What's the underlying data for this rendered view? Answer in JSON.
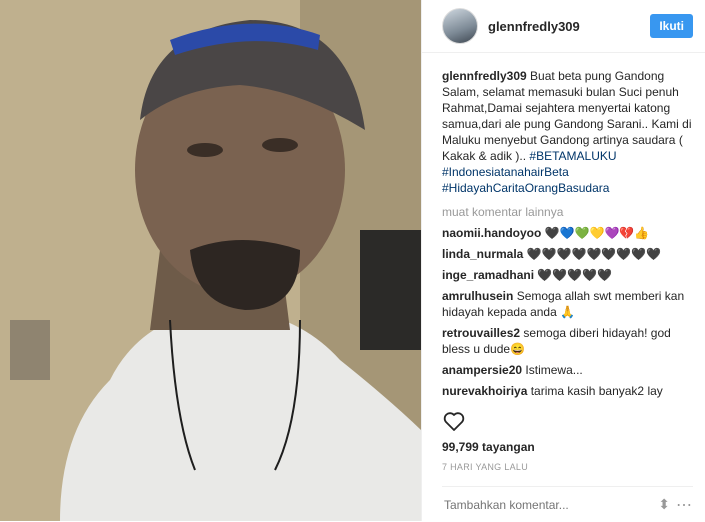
{
  "header": {
    "username": "glennfredly309",
    "follow_label": "Ikuti"
  },
  "caption": {
    "username": "glennfredly309",
    "text": "Buat beta pung Gandong Salam, selamat memasuki bulan Suci penuh Rahmat,Damai sejahtera menyertai katong samua,dari ale pung Gandong Sarani.. Kami di Maluku menyebut Gandong artinya saudara ( Kakak & adik )..",
    "tags": "#BETAMALUKU #IndonesiatanahairBeta #HidayahCaritaOrangBasudara"
  },
  "more_comments_label": "muat komentar lainnya",
  "comments": [
    {
      "username": "naomii.handoyoo",
      "text": "🖤💙💚💛💜💔👍"
    },
    {
      "username": "linda_nurmala",
      "text": "🖤🖤🖤🖤🖤🖤🖤🖤🖤"
    },
    {
      "username": "inge_ramadhani",
      "text": "🖤🖤🖤🖤🖤"
    },
    {
      "username": "amrulhusein",
      "text": "Semoga allah swt memberi kan hidayah kepada anda 🙏"
    },
    {
      "username": "retrouvailles2",
      "text": "semoga diberi hidayah! god bless u dude😄"
    },
    {
      "username": "anampersie20",
      "text": "Istimewa..."
    },
    {
      "username": "nurevakhoiriya",
      "text": "tarima kasih banyak2 lay"
    }
  ],
  "views": "99,799 tayangan",
  "timestamp": "7 HARI YANG LALU",
  "add_comment": {
    "placeholder": "Tambahkan komentar..."
  },
  "icons": {
    "like": "heart-icon",
    "options": "more-options-icon"
  }
}
